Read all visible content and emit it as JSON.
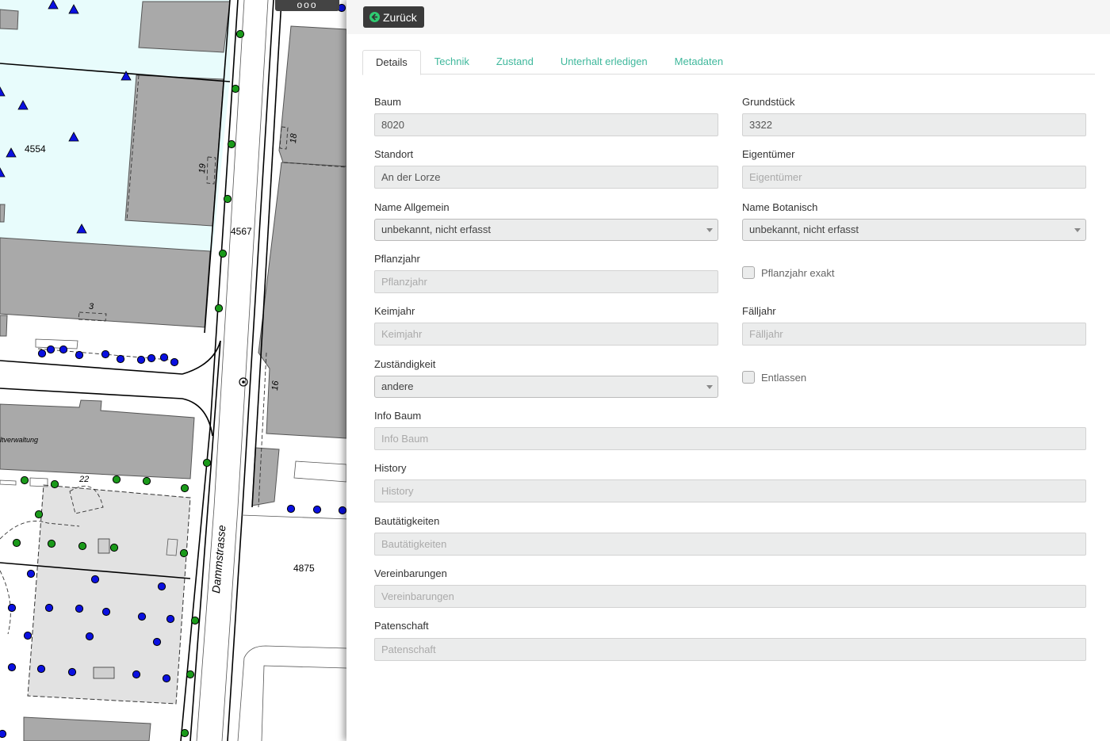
{
  "map": {
    "labels": {
      "parcel_4554": "4554",
      "parcel_4567": "4567",
      "parcel_4875": "4875",
      "house_19": "19",
      "house_18": "18",
      "house_16": "16",
      "house_3": "3",
      "house_22": "22",
      "street": "Dammstrasse",
      "building": "ltverwaltung"
    },
    "colors": {
      "tree_green": "#1a9a1a",
      "tree_blue": "#0a10e0",
      "parcel_fill": "#e8fcfc",
      "building_fill": "#a9a9a9"
    },
    "handle_label": "ooo"
  },
  "panel": {
    "back_button": {
      "label": "Zurück",
      "icon": "arrow-left-circle-icon"
    },
    "tabs": [
      {
        "label": "Details",
        "active": true
      },
      {
        "label": "Technik",
        "active": false
      },
      {
        "label": "Zustand",
        "active": false
      },
      {
        "label": "Unterhalt erledigen",
        "active": false
      },
      {
        "label": "Metadaten",
        "active": false
      }
    ],
    "form": {
      "baum": {
        "label": "Baum",
        "value": "8020"
      },
      "grundstueck": {
        "label": "Grundstück",
        "value": "3322"
      },
      "standort": {
        "label": "Standort",
        "value": "An der Lorze"
      },
      "eigentuemer": {
        "label": "Eigentümer",
        "placeholder": "Eigentümer"
      },
      "name_allgemein": {
        "label": "Name Allgemein",
        "value": "unbekannt, nicht erfasst"
      },
      "name_botanisch": {
        "label": "Name Botanisch",
        "value": "unbekannt, nicht erfasst"
      },
      "pflanzjahr": {
        "label": "Pflanzjahr",
        "placeholder": "Pflanzjahr"
      },
      "pflanzjahr_exakt": {
        "label": "Pflanzjahr exakt",
        "checked": false
      },
      "keimjahr": {
        "label": "Keimjahr",
        "placeholder": "Keimjahr"
      },
      "faelljahr": {
        "label": "Fälljahr",
        "placeholder": "Fälljahr"
      },
      "zustaendigkeit": {
        "label": "Zuständigkeit",
        "value": "andere"
      },
      "entlassen": {
        "label": "Entlassen",
        "checked": false
      },
      "info_baum": {
        "label": "Info Baum",
        "placeholder": "Info Baum"
      },
      "history": {
        "label": "History",
        "placeholder": "History"
      },
      "bautaetigkeiten": {
        "label": "Bautätigkeiten",
        "placeholder": "Bautätigkeiten"
      },
      "vereinbarungen": {
        "label": "Vereinbarungen",
        "placeholder": "Vereinbarungen"
      },
      "patenschaft": {
        "label": "Patenschaft",
        "placeholder": "Patenschaft"
      }
    }
  }
}
